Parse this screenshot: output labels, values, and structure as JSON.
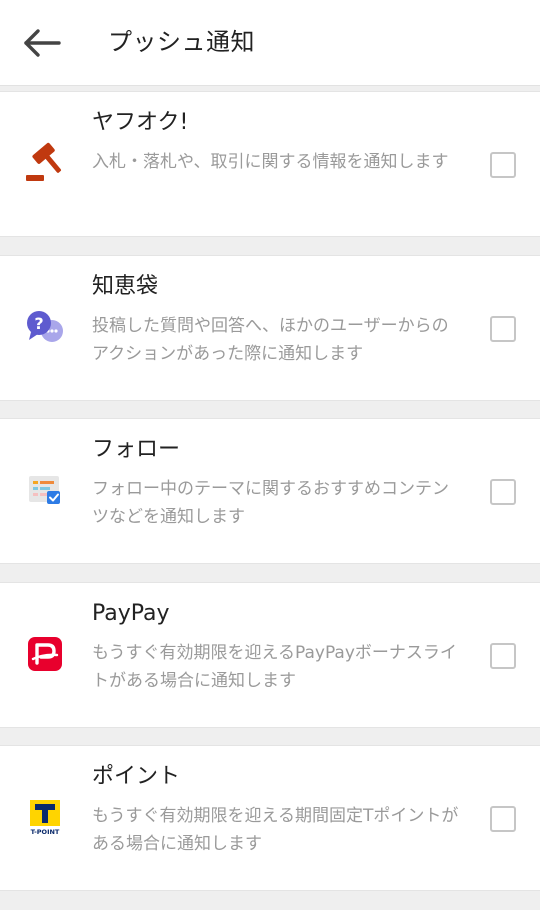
{
  "header": {
    "title": "プッシュ通知"
  },
  "items": [
    {
      "title": "ヤフオク!",
      "description": "入札・落札や、取引に関する情報を通知します",
      "checked": false,
      "icon": "auction-gavel-icon"
    },
    {
      "title": "知恵袋",
      "description": "投稿した質問や回答へ、ほかのユーザーからのアクションがあった際に通知します",
      "checked": false,
      "icon": "question-bubble-icon"
    },
    {
      "title": "フォロー",
      "description": "フォロー中のテーマに関するおすすめコンテンツなどを通知します",
      "checked": false,
      "icon": "follow-feed-icon"
    },
    {
      "title": "PayPay",
      "description": "もうすぐ有効期限を迎えるPayPayボーナスライトがある場合に通知します",
      "checked": false,
      "icon": "paypay-logo-icon"
    },
    {
      "title": "ポイント",
      "description": "もうすぐ有効期限を迎える期間固定Tポイントがある場合に通知します",
      "checked": false,
      "icon": "tpoint-logo-icon"
    }
  ],
  "colors": {
    "auction": "#c0390f",
    "chiebukuro": "#6b6bd6",
    "paypay": "#e8002d",
    "tpoint_yellow": "#ffd400",
    "tpoint_navy": "#0a2a6b"
  }
}
